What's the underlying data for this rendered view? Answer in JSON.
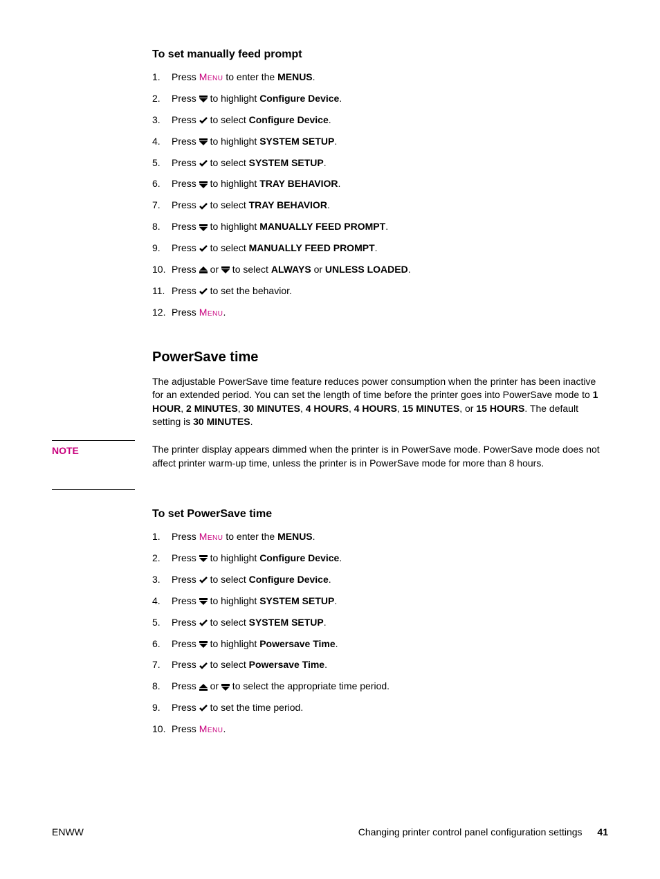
{
  "section1": {
    "heading": "To set manually feed prompt",
    "steps": [
      {
        "n": "1.",
        "pre": "Press ",
        "menu": "Menu",
        "mid": " to enter the ",
        "bold": "MENUS",
        "post": "."
      },
      {
        "n": "2.",
        "pre": "Press ",
        "icon": "down",
        "mid": " to highlight ",
        "bold": "Configure Device",
        "post": "."
      },
      {
        "n": "3.",
        "pre": "Press ",
        "icon": "check",
        "mid": " to select ",
        "bold": "Configure Device",
        "post": "."
      },
      {
        "n": "4.",
        "pre": "Press ",
        "icon": "down",
        "mid": " to highlight ",
        "bold": "SYSTEM SETUP",
        "post": "."
      },
      {
        "n": "5.",
        "pre": "Press ",
        "icon": "check",
        "mid": " to select ",
        "bold": "SYSTEM SETUP",
        "post": "."
      },
      {
        "n": "6.",
        "pre": "Press ",
        "icon": "down",
        "mid": " to highlight ",
        "bold": "TRAY BEHAVIOR",
        "post": "."
      },
      {
        "n": "7.",
        "pre": "Press ",
        "icon": "check",
        "mid": " to select ",
        "bold": "TRAY BEHAVIOR",
        "post": "."
      },
      {
        "n": "8.",
        "pre": "Press ",
        "icon": "down",
        "mid": " to highlight ",
        "bold": "MANUALLY FEED PROMPT",
        "post": "."
      },
      {
        "n": "9.",
        "pre": "Press ",
        "icon": "check",
        "mid": " to select ",
        "bold": "MANUALLY FEED PROMPT",
        "post": "."
      },
      {
        "n": "10.",
        "pre": "Press ",
        "icon": "up",
        "mid2": " or ",
        "icon2": "down",
        "mid": " to select ",
        "bold": "ALWAYS",
        "mid3": " or ",
        "bold2": "UNLESS LOADED",
        "post": "."
      },
      {
        "n": "11.",
        "pre": "Press ",
        "icon": "check",
        "mid": " to set the behavior.",
        "bold": "",
        "post": ""
      },
      {
        "n": "12.",
        "pre": "Press ",
        "menu": "Menu",
        "mid": "",
        "bold": "",
        "post": "."
      }
    ]
  },
  "section2": {
    "heading": "PowerSave time",
    "para_pre": "The adjustable PowerSave time feature reduces power consumption when the printer has been inactive for an extended period. You can set the length of time before the printer goes into PowerSave mode to ",
    "opts": [
      "1 HOUR",
      "2 MINUTES",
      "30 MINUTES",
      "4 HOURS",
      "4 HOURS",
      "15 MINUTES",
      "15 HOURS"
    ],
    "para_mid": ". The default setting is ",
    "default": "30 MINUTES",
    "para_post": "."
  },
  "note": {
    "label": "NOTE",
    "body": "The printer display appears dimmed when the printer is in PowerSave mode. PowerSave mode does not affect printer warm-up time, unless the printer is in PowerSave mode for more than 8 hours."
  },
  "section3": {
    "heading": "To set PowerSave time",
    "steps": [
      {
        "n": "1.",
        "pre": "Press ",
        "menu": "Menu",
        "mid": " to enter the ",
        "bold": "MENUS",
        "post": "."
      },
      {
        "n": "2.",
        "pre": "Press ",
        "icon": "down",
        "mid": " to highlight ",
        "bold": "Configure Device",
        "post": "."
      },
      {
        "n": "3.",
        "pre": "Press ",
        "icon": "check",
        "mid": " to select ",
        "bold": "Configure Device",
        "post": "."
      },
      {
        "n": "4.",
        "pre": "Press ",
        "icon": "down",
        "mid": " to highlight ",
        "bold": "SYSTEM SETUP",
        "post": "."
      },
      {
        "n": "5.",
        "pre": "Press ",
        "icon": "check",
        "mid": " to select ",
        "bold": "SYSTEM SETUP",
        "post": "."
      },
      {
        "n": "6.",
        "pre": "Press ",
        "icon": "down",
        "mid": " to highlight ",
        "bold": "Powersave Time",
        "post": "."
      },
      {
        "n": "7.",
        "pre": "Press ",
        "icon": "check",
        "mid": " to select ",
        "bold": "Powersave Time",
        "post": "."
      },
      {
        "n": "8.",
        "pre": "Press ",
        "icon": "up",
        "mid2": " or ",
        "icon2": "down",
        "mid": " to select the appropriate time period.",
        "bold": "",
        "post": ""
      },
      {
        "n": "9.",
        "pre": "Press ",
        "icon": "check",
        "mid": " to set the time period.",
        "bold": "",
        "post": ""
      },
      {
        "n": "10.",
        "pre": "Press ",
        "menu": "Menu",
        "mid": "",
        "bold": "",
        "post": "."
      }
    ]
  },
  "footer": {
    "left": "ENWW",
    "right": "Changing printer control panel configuration settings",
    "page": "41"
  }
}
